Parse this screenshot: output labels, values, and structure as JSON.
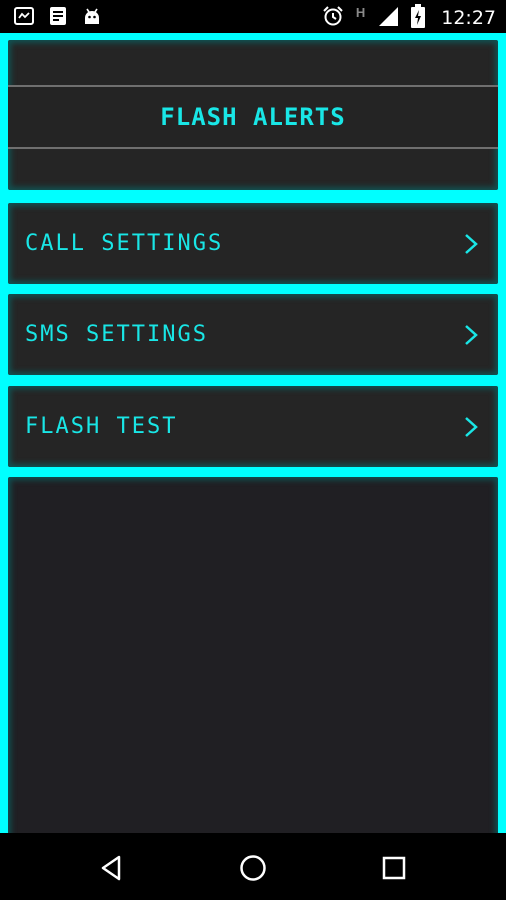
{
  "status_bar": {
    "time": "12:27",
    "network_indicator": "H",
    "left_icons": [
      "screen-mirror-icon",
      "notes-icon",
      "android-icon"
    ],
    "right_icons": [
      "alarm-icon",
      "signal-icon",
      "battery-charging-icon"
    ]
  },
  "header": {
    "title": "FLASH ALERTS"
  },
  "menu": {
    "items": [
      {
        "label": "CALL SETTINGS",
        "icon": "chevron-right-icon"
      },
      {
        "label": "SMS SETTINGS",
        "icon": "chevron-right-icon"
      },
      {
        "label": "FLASH TEST",
        "icon": "chevron-right-icon"
      }
    ]
  },
  "nav_bar": {
    "icons": [
      "back-icon",
      "home-icon",
      "recents-icon"
    ]
  },
  "colors": {
    "accent": "#00ffff",
    "text_accent": "#19e6e6",
    "panel": "#252525"
  }
}
